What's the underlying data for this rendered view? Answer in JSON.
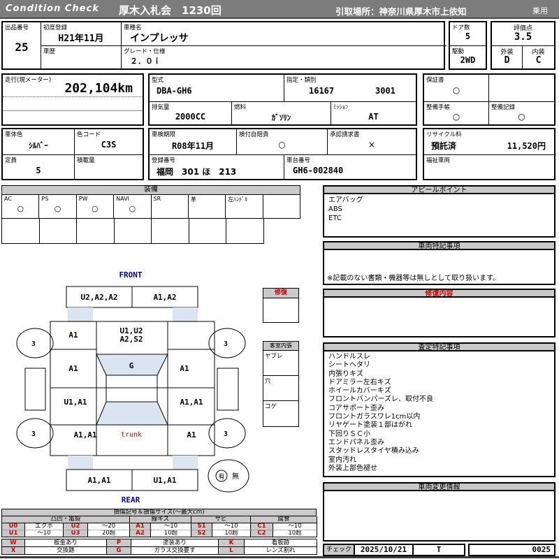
{
  "colors": {
    "bar_gray": "#7c7c7c",
    "header_gray": "#c9c9c9",
    "shade_blue": "#dbe5f1",
    "accent_red": "#cc0000",
    "accent_blue": "#0000bb"
  },
  "header": {
    "logo": "Condition  Check",
    "auction_title": "厚木入札会　1230回",
    "pickup_location": "引取場所：神奈川県厚木市上依知",
    "vehicle_use": "乗用"
  },
  "info": {
    "lot_label": "出品番号",
    "lot_no": "25",
    "first_reg_label": "初度登録",
    "first_reg": "H21年11月",
    "model_label": "車種名",
    "model_name": "インプレッサ",
    "doors_label": "ドア数",
    "doors": "5",
    "score_label": "評価点",
    "score": "3.5",
    "history_label": "車歴",
    "history": "",
    "grade_label": "グレード・仕様",
    "grade": "２．０ｉ",
    "drive_label": "駆動",
    "drive": "2WD",
    "exterior_label": "外装",
    "exterior_grade": "D",
    "interior_label": "内装",
    "interior_grade": "C"
  },
  "specs": {
    "mileage_label": "走行(現メーター)",
    "mileage": "202,104km",
    "model_code_label": "型式",
    "model_code": "DBA-GH6",
    "class_label": "指定・類別",
    "class_no": "16167",
    "type_no": "3001",
    "warranty_label": "保証書",
    "warranty_mark": "○",
    "displacement_label": "排気量",
    "displacement": "2000CC",
    "fuel_label": "燃料",
    "fuel": "ｶﾞｿﾘﾝ",
    "mission_label": "ﾐｯｼｮﾝ",
    "mission": "AT",
    "maintenance_book_label": "整備手帳",
    "maintenance_book_mark": "○",
    "maintenance_record_label": "整備記録",
    "maintenance_record_mark": "○"
  },
  "registration": {
    "body_color_label": "車体色",
    "body_color": "ｼﾙﾊﾞｰ",
    "color_code_label": "色コード",
    "color_code": "C3S",
    "inspection_label": "車検期限",
    "inspection_expiry": "R08年11月",
    "insurance_label": "検付自賠責",
    "insurance_mark": "○",
    "approval_label": "承認請求書",
    "approval_mark": "×",
    "recycle_label": "リサイクル料",
    "recycle_status": "預託済",
    "recycle_fee": "11,520円",
    "capacity_label": "定員",
    "capacity": "5",
    "load_label": "積載量",
    "load": "",
    "plate_label": "登録番号",
    "plate_no": "福岡　301 ほ　213",
    "chassis_label": "車台番号",
    "chassis_no": "GH6-002840",
    "welfare_label": "福祉車両",
    "welfare": ""
  },
  "equipment": {
    "title": "装備",
    "items": [
      {
        "label": "AC",
        "mark": "○"
      },
      {
        "label": "PS",
        "mark": "○"
      },
      {
        "label": "PW",
        "mark": "○"
      },
      {
        "label": "NAVI",
        "mark": "○"
      },
      {
        "label": "SR",
        "mark": ""
      },
      {
        "label": "革",
        "mark": ""
      },
      {
        "label": "左ﾊﾝﾄﾞﾙ",
        "mark": ""
      },
      {
        "label": "",
        "mark": ""
      }
    ]
  },
  "appeal": {
    "title": "アピールポイント",
    "items": [
      "エアバッグ",
      "ABS",
      "ETC"
    ]
  },
  "special_notes": {
    "title": "車両特記事項",
    "note": "※記載のない書類・機器等は無しとして取り扱います。"
  },
  "repair_details": {
    "title": "修復内容",
    "content": ""
  },
  "assessment": {
    "title": "査定特記事項",
    "items": [
      "ハンドルスレ",
      "シートヘタリ",
      "内張りキズ",
      "ドアミラー左右キズ",
      "ホイールカバーキズ",
      "フロントバンパーズレ、取付不良",
      "コアサポート歪み",
      "フロントガラスワレ1cm以内",
      "リヤゲート塗装１部はがれ",
      "下回りＳＣ小",
      "エンドパネル歪み",
      "スタッドレスタイヤ積み込み",
      "室内汚れ",
      "外装上部色褪せ"
    ]
  },
  "change_info": {
    "title": "車両変更情報",
    "content": ""
  },
  "check": {
    "label": "チェック",
    "date": "2025/10/21",
    "inspector": "T",
    "sheet_no": "0025"
  },
  "diagram": {
    "front_label": "FRONT",
    "rear_label": "REAR",
    "front_bumper_left": "U2,A2,A2",
    "front_bumper_right": "A1,A2",
    "front_fender_left": "A1",
    "hood_line1": "U1,U2",
    "hood_line2": "A2,S2",
    "front_door_left": "A1",
    "windshield_mark": "G",
    "front_door_right": "A1",
    "rear_door_left": "U1,A1",
    "rear_door_right": "A1,A1",
    "quarter_left": "A1,A1",
    "trunk_label": "trunk",
    "quarter_right": "A1",
    "rear_bumper_left": "A1,A1",
    "rear_bumper_right": "U1,A1",
    "wheel_mark": "3",
    "spare_yes": "有",
    "spare_no": "無",
    "repair_box_title": "修復",
    "cabin_box_title": "客室内張",
    "cabin_rows": [
      "ヤブレ",
      "穴",
      "コゲ"
    ]
  },
  "legend": {
    "title": "損傷記号＆損傷サイズ(〜最大cm)",
    "groups": [
      "凸凹・亀裂",
      "線キズ",
      "サビ",
      "腐食"
    ],
    "row1": [
      [
        "U0",
        "エクボ"
      ],
      [
        "U2",
        "〜20"
      ],
      [
        "A1",
        "〜10"
      ],
      [
        "S1",
        "〜10"
      ],
      [
        "C1",
        "〜10"
      ]
    ],
    "row2": [
      [
        "U1",
        "〜10"
      ],
      [
        "U3",
        "20超"
      ],
      [
        "A2",
        "10超"
      ],
      [
        "S2",
        "10超"
      ],
      [
        "C2",
        "10超"
      ]
    ],
    "extra1": [
      [
        "W",
        "板金あり"
      ],
      [
        "P",
        "塗装あり"
      ],
      [
        "K",
        "看板跡"
      ]
    ],
    "extra2": [
      [
        "X",
        "交換跡"
      ],
      [
        "G",
        "ガラス交換要す"
      ],
      [
        "L",
        "レンズ割れ"
      ]
    ]
  }
}
